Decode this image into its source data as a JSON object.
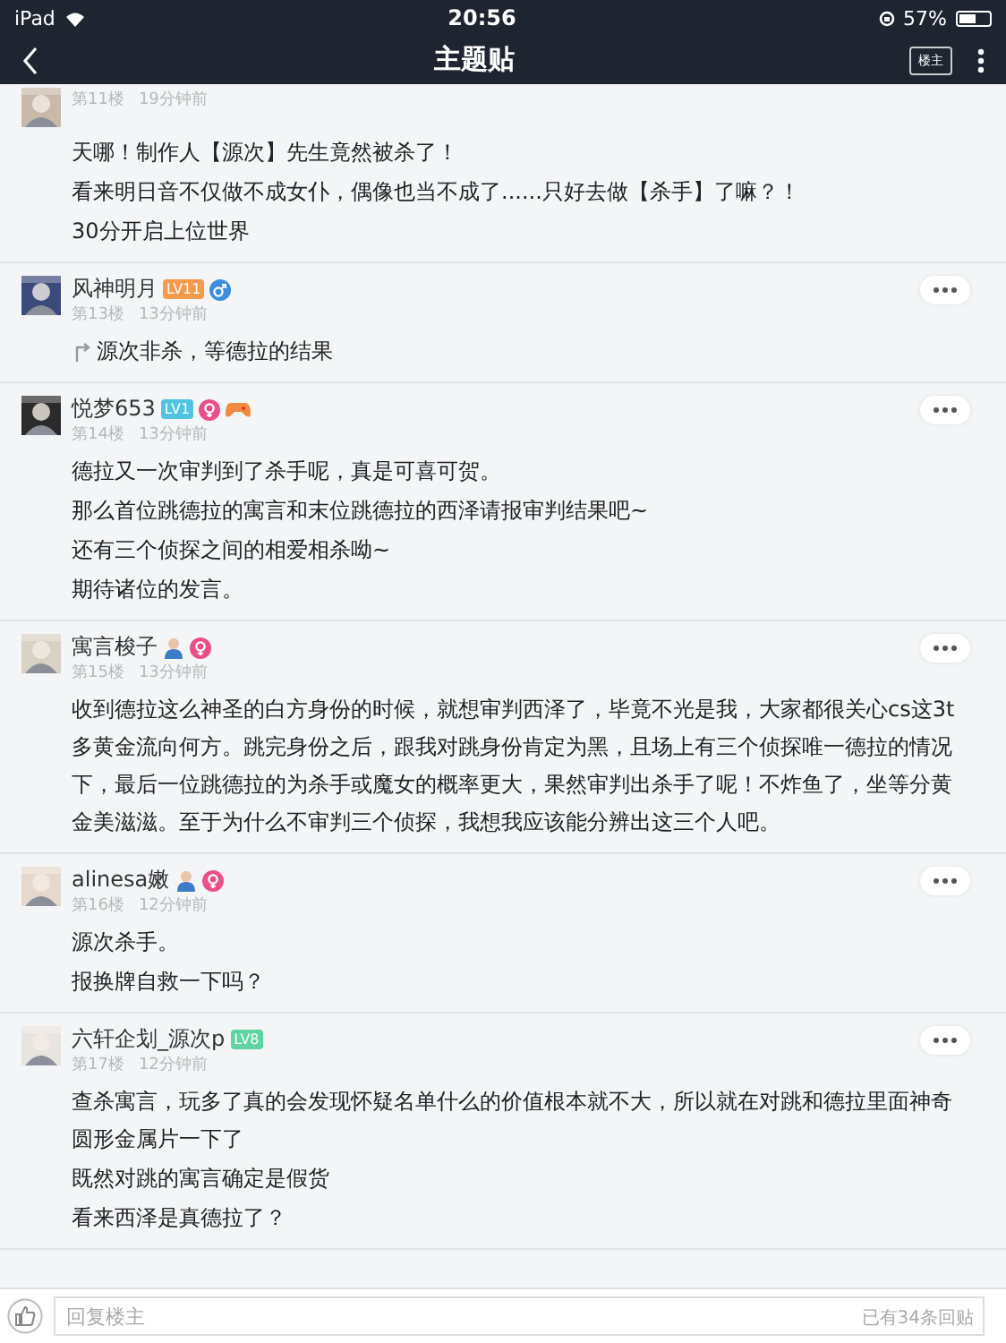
{
  "status_bar": {
    "device": "iPad",
    "time": "20:56",
    "battery": "57%"
  },
  "nav": {
    "title": "主题贴",
    "owner_button": "楼主"
  },
  "posts": [
    {
      "floor": "第11楼",
      "time": "19分钟前",
      "paragraphs": [
        "天哪！制作人【源次】先生竟然被杀了！",
        "看来明日音不仅做不成女仆，偶像也当不成了......只好去做【杀手】了嘛？！",
        "30分开启上位世界"
      ]
    },
    {
      "user": "风神明月",
      "badges": [
        {
          "kind": "level",
          "text": "LV11",
          "color": "#f39b4a"
        },
        {
          "kind": "male"
        }
      ],
      "floor": "第13楼",
      "time": "13分钟前",
      "reposted": true,
      "paragraphs": [
        "源次非杀，等德拉的结果"
      ]
    },
    {
      "user": "悦梦653",
      "badges": [
        {
          "kind": "level",
          "text": "LV1",
          "color": "#4fc3e0"
        },
        {
          "kind": "female"
        },
        {
          "kind": "game"
        }
      ],
      "floor": "第14楼",
      "time": "13分钟前",
      "paragraphs": [
        "德拉又一次审判到了杀手呢，真是可喜可贺。",
        "那么首位跳德拉的寓言和末位跳德拉的西泽请报审判结果吧~",
        "还有三个侦探之间的相爱相杀呦~",
        "期待诸位的发言。"
      ]
    },
    {
      "user": "寓言梭子",
      "badges": [
        {
          "kind": "person"
        },
        {
          "kind": "female"
        }
      ],
      "floor": "第15楼",
      "time": "13分钟前",
      "paragraphs": [
        "收到德拉这么神圣的白方身份的时候，就想审判西泽了，毕竟不光是我，大家都很关心cs这3t多黄金流向何方。跳完身份之后，跟我对跳身份肯定为黑，且场上有三个侦探唯一德拉的情况下，最后一位跳德拉的为杀手或魔女的概率更大，果然审判出杀手了呢！不炸鱼了，坐等分黄金美滋滋。至于为什么不审判三个侦探，我想我应该能分辨出这三个人吧。"
      ]
    },
    {
      "user": "alinesa嫩",
      "badges": [
        {
          "kind": "person"
        },
        {
          "kind": "female"
        }
      ],
      "floor": "第16楼",
      "time": "12分钟前",
      "paragraphs": [
        "源次杀手。",
        "报换牌自救一下吗？"
      ]
    },
    {
      "user": "六轩企划_源次p",
      "badges": [
        {
          "kind": "level",
          "text": "LV8",
          "color": "#5fd3a0"
        }
      ],
      "floor": "第17楼",
      "time": "12分钟前",
      "paragraphs": [
        "查杀寓言，玩多了真的会发现怀疑名单什么的价值根本就不大，所以就在对跳和德拉里面神奇圆形金属片一下了",
        "既然对跳的寓言确定是假货",
        "看来西泽是真德拉了？"
      ]
    }
  ],
  "reply_bar": {
    "placeholder": "回复楼主",
    "count": "已有34条回贴"
  }
}
